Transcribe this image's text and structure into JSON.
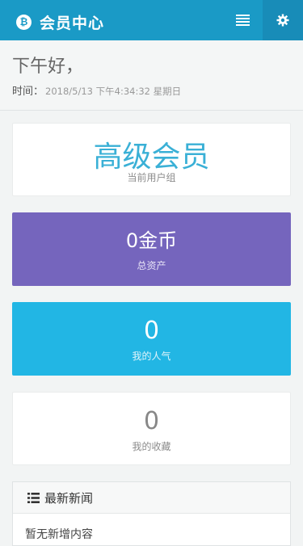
{
  "header": {
    "brand_icon": "bitcoin-icon",
    "title": "会员中心",
    "menu_icon": "list-icon",
    "settings_icon": "gear-icon",
    "background": "#1a9ac6"
  },
  "greeting": {
    "text": "下午好，",
    "time_label": "时间：",
    "time_value": "2018/5/13 下午4:34:32 星期日"
  },
  "cards": {
    "level": {
      "value": "高级会员",
      "label": "当前用户组",
      "color": "#ffffff"
    },
    "gold": {
      "value": "0金币",
      "label": "总资产",
      "color": "#7565bd"
    },
    "popularity": {
      "value": "0",
      "label": "我的人气",
      "color": "#22b6e4"
    },
    "favorites": {
      "value": "0",
      "label": "我的收藏",
      "color": "#ffffff"
    }
  },
  "news": {
    "icon": "list-icon",
    "title": "最新新闻",
    "empty_text": "暂无新增内容"
  }
}
